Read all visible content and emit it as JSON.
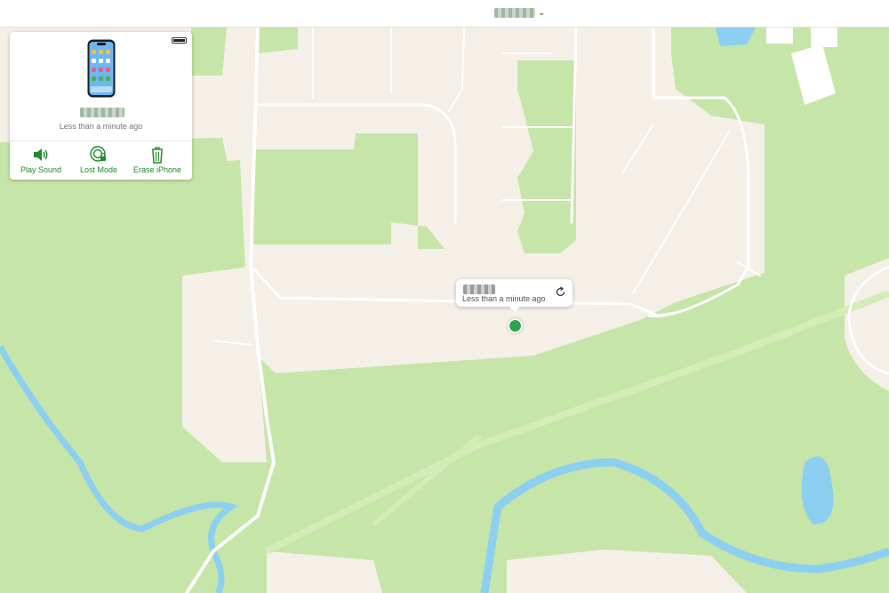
{
  "topbar": {
    "chevron_glyph": "⌄"
  },
  "device_panel": {
    "last_seen": "Less than a minute ago",
    "actions": [
      {
        "label": "Play Sound",
        "icon": "speaker-icon"
      },
      {
        "label": "Lost Mode",
        "icon": "lost-mode-icon"
      },
      {
        "label": "Erase iPhone",
        "icon": "trash-icon"
      }
    ]
  },
  "map_callout": {
    "time": "Less than a minute ago",
    "refresh_icon": "refresh-icon"
  },
  "colors": {
    "accent": "#1f8a2e",
    "pin": "#2ea44f",
    "park": "#c6e5a8",
    "water": "#8dcff0",
    "land": "#f4efe7"
  }
}
